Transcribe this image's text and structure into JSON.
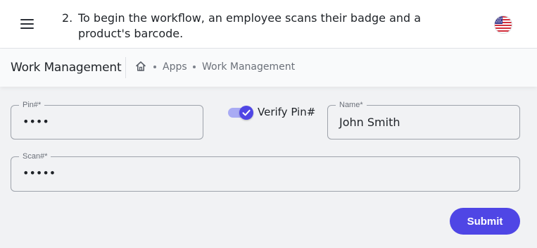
{
  "header": {
    "instruction_number": "2.",
    "instruction_text": "To begin the workflow, an employee scans their badge and a product's barcode."
  },
  "breadcrumb": {
    "title": "Work Management",
    "items": [
      "Apps",
      "Work Management"
    ]
  },
  "form": {
    "pin": {
      "label": "Pin#*",
      "value": "••••"
    },
    "verify_pin": {
      "label": "Verify Pin#",
      "checked": true
    },
    "name": {
      "label": "Name*",
      "value": "John Smith"
    },
    "scan": {
      "label": "Scan#*",
      "value": "•••••"
    },
    "submit_label": "Submit"
  },
  "icons": {
    "menu": "hamburger-menu-icon",
    "language": "us-flag-icon",
    "home": "home-icon",
    "check": "check-icon"
  },
  "colors": {
    "accent": "#4f46e5",
    "accent_light": "#a9abf4",
    "page_bg": "#f1f2f4"
  }
}
